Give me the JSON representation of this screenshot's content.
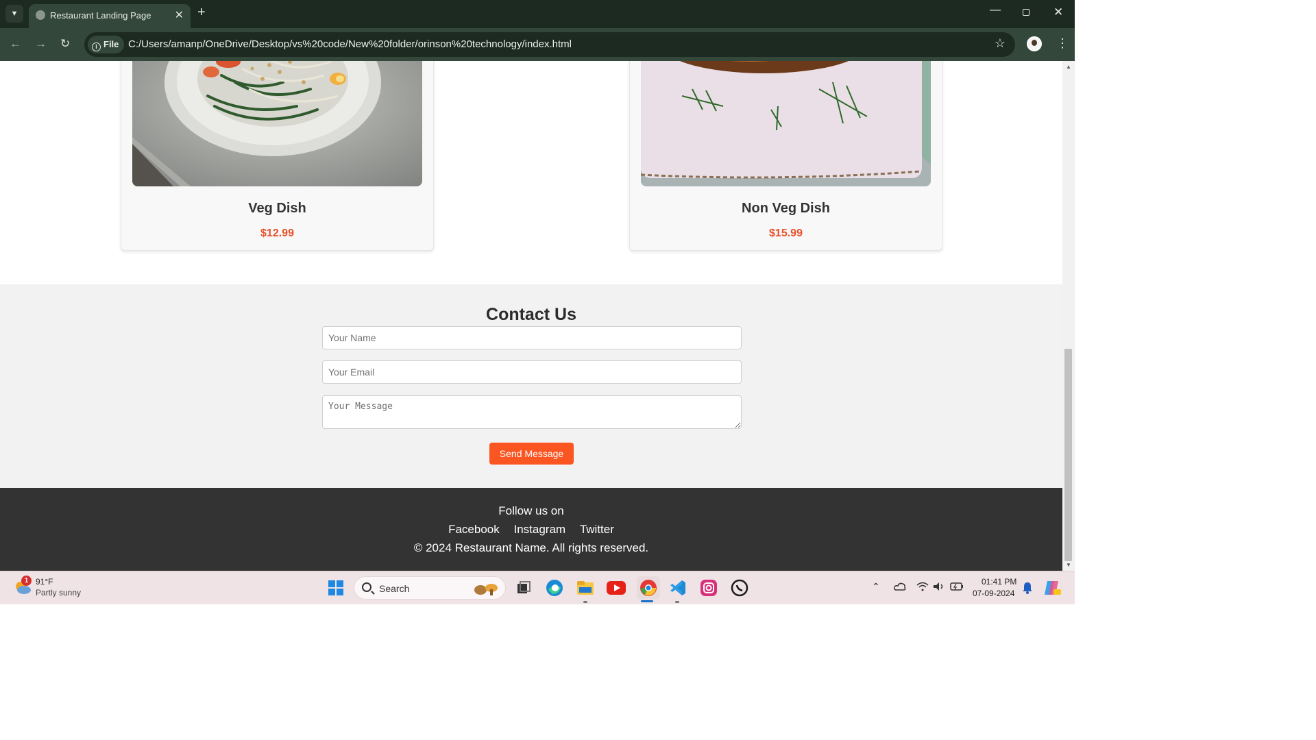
{
  "browser": {
    "tab_title": "Restaurant Landing Page",
    "file_chip": "File",
    "url": "C:/Users/amanp/OneDrive/Desktop/vs%20code/New%20folder/orinson%20technology/index.html"
  },
  "menu": {
    "items": [
      {
        "name": "Veg Dish",
        "price": "$12.99"
      },
      {
        "name": "Non Veg Dish",
        "price": "$15.99"
      }
    ]
  },
  "contact": {
    "title": "Contact Us",
    "name_placeholder": "Your Name",
    "email_placeholder": "Your Email",
    "message_placeholder": "Your Message",
    "send_label": "Send Message"
  },
  "footer": {
    "follow": "Follow us on",
    "links": [
      "Facebook",
      "Instagram",
      "Twitter"
    ],
    "copyright": "© 2024 Restaurant Name. All rights reserved."
  },
  "taskbar": {
    "weather_badge": "1",
    "temperature": "91°F",
    "weather_desc": "Partly sunny",
    "search_label": "Search",
    "time": "01:41 PM",
    "date": "07-09-2024"
  },
  "colors": {
    "accent": "#fb5522",
    "price": "#e8512a",
    "footer_bg": "#333333",
    "chrome_dark": "#1c2a21",
    "chrome_toolbar": "#33473a"
  }
}
